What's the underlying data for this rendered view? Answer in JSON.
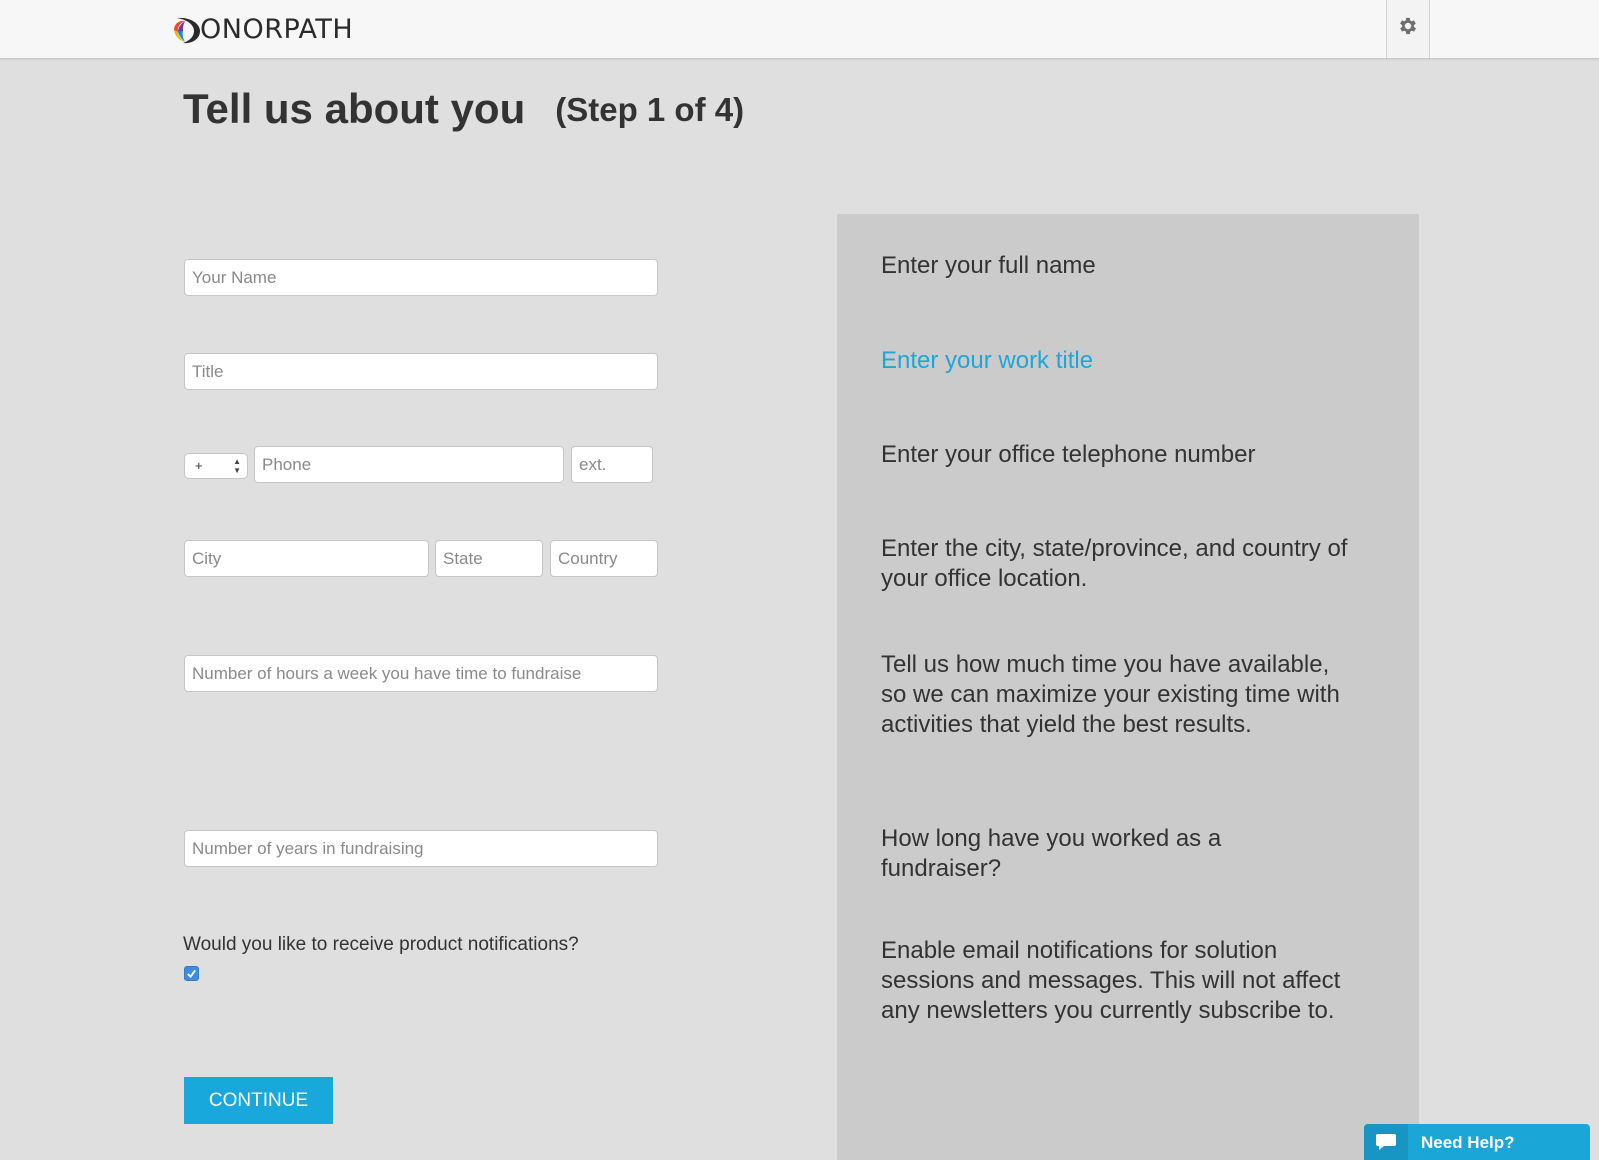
{
  "header": {
    "logo_text": "ONORPATH",
    "logo_letter": "D",
    "settings_icon": "gear-icon"
  },
  "page": {
    "title": "Tell us about you",
    "step": "(Step 1 of 4)"
  },
  "form": {
    "name_placeholder": "Your Name",
    "title_placeholder": "Title",
    "phone_prefix": "+",
    "phone_placeholder": "Phone",
    "ext_placeholder": "ext.",
    "city_placeholder": "City",
    "state_placeholder": "State",
    "country_placeholder": "Country",
    "hours_placeholder": "Number of hours a week you have time to fundraise",
    "years_placeholder": "Number of years in fundraising",
    "notifications_question": "Would you like to receive product notifications?",
    "notifications_checked": true,
    "continue_label": "CONTINUE"
  },
  "help": {
    "name": "Enter your full name",
    "title": "Enter your work title",
    "phone": "Enter your office telephone number",
    "location": "Enter the city, state/province, and country of your office location.",
    "hours": "Tell us how much time you have available, so we can maximize your existing time with activities that yield the best results.",
    "years": "How long have you worked as a fundraiser?",
    "notifications": "Enable email notifications for solution sessions and messages. This will not affect any newsletters you currently subscribe to."
  },
  "support": {
    "need_help_label": "Need Help?",
    "icon": "chat-bubble-icon"
  },
  "colors": {
    "accent": "#18a8db",
    "active_help": "#1fa6d8",
    "background": "#dfdfdf",
    "help_panel": "#cbcbcb"
  }
}
